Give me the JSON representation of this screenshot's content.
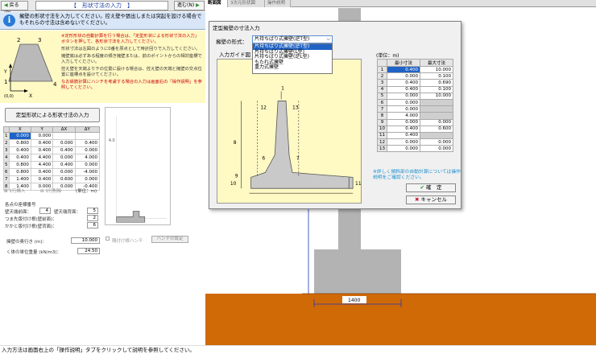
{
  "nav": {
    "back_label": "戻る(P)",
    "next_label": "進む(N)",
    "title": "【　形状寸法の入力　】"
  },
  "info": {
    "text": "擁壁の形状寸法を入力してください。控え壁や張出しまたは突起を設ける場合でもそれらの寸法は含めないでください。"
  },
  "help": {
    "p1": "※定形形状の自動計算を行う場合は、「定型形状による形状寸法の入力」ボタンを押して、各形状寸法を入力してください。",
    "p2": "形状寸法は左図のように0番を原点として時計回りで入力してください。",
    "p3": "擁壁底は必ずある程度の傾き擁壁または、前のポイントからの相対座標で入力してください。",
    "p4": "控え壁を天端より下の位置に設ける場合は、控え壁の天端と擁壁の交点位置に座標点を設けてください。",
    "p5": "なお鉄筋計算にハンチを考慮する場合の入力は画面右の「操作説明」を参照してください。",
    "pt_labels": [
      "2",
      "3",
      "1",
      "4",
      "Y",
      "X",
      "(0,0)"
    ]
  },
  "shape_button_label": "定型形状による形状寸法の入力",
  "coord_table": {
    "headers": [
      "",
      "X",
      "Y",
      "ΔX",
      "ΔY"
    ],
    "rows": [
      [
        "1",
        "0.000",
        "0.000",
        "",
        ""
      ],
      [
        "2",
        "0.800",
        "0.400",
        "0.000",
        "0.400"
      ],
      [
        "3",
        "0.400",
        "0.400",
        "0.400",
        "0.000"
      ],
      [
        "4",
        "0.400",
        "4.400",
        "0.000",
        "4.000"
      ],
      [
        "5",
        "0.800",
        "4.400",
        "0.400",
        "0.000"
      ],
      [
        "6",
        "0.800",
        "0.400",
        "0.000",
        "-4.000"
      ],
      [
        "7",
        "1.400",
        "0.400",
        "0.600",
        "0.000"
      ],
      [
        "8",
        "1.400",
        "0.000",
        "0.000",
        "-0.400"
      ]
    ]
  },
  "row_ops": {
    "insert": "1行挿入",
    "delete": "1行削除",
    "unit": "(単位：m)"
  },
  "mini_prev": {
    "ylabel": "4.0"
  },
  "points": {
    "title": "各点の座標番号",
    "front_top_label": "壁天端前面：",
    "front_top": "4",
    "back_top_label": "壁天端背面：",
    "back_top": "5",
    "toe_label": "つま先版付け根(壁前面)：",
    "toe": "2",
    "heel_label": "かかと版付け根(壁背面)：",
    "heel": "6"
  },
  "fields": {
    "depth_label": "擁壁の奥行き (m)：",
    "depth_value": "10.000",
    "weight_label": "く体の単位重量 (kN/m3)：",
    "weight_value": "24.50",
    "haunch_check": "隅付け根ハンチ",
    "haunch_btn": "ハンチの設定"
  },
  "status": "入力方法は画面右上の「操作説明」タブをクリックして説明を参照してください。",
  "tabs": [
    "断面図",
    "3次元形状図",
    "操作説明"
  ],
  "drawing": {
    "dim_label": "1400"
  },
  "dialog": {
    "title": "定型擁壁の寸法入力",
    "wall_type_label": "擁壁の形式：",
    "wall_type_value": "片持ちばり式擁壁(逆T型)",
    "guide_label": "入力ガイド図",
    "options": [
      "片持ちばり式擁壁(逆T型)",
      "片持ちばり式擁壁(L型)",
      "片持ちばり式擁壁(逆L型)",
      "もたれ式擁壁",
      "重力式擁壁"
    ],
    "unit": "(単位：m)",
    "table_headers": [
      "",
      "最小寸法",
      "最大寸法"
    ],
    "table_rows": [
      [
        "1",
        "0.400",
        "10.000"
      ],
      [
        "2",
        "0.000",
        "0.100"
      ],
      [
        "3",
        "0.400",
        "0.690"
      ],
      [
        "4",
        "0.400",
        "0.100"
      ],
      [
        "5",
        "0.000",
        "10.000"
      ],
      [
        "6",
        "0.000",
        ""
      ],
      [
        "7",
        "0.000",
        ""
      ],
      [
        "8",
        "4.000",
        ""
      ],
      [
        "9",
        "0.000",
        "0.000"
      ],
      [
        "10",
        "0.400",
        "0.600"
      ],
      [
        "11",
        "0.400",
        ""
      ],
      [
        "12",
        "0.000",
        "0.000"
      ],
      [
        "13",
        "0.000",
        "0.000"
      ]
    ],
    "guide_numbers": [
      "1",
      "12",
      "13",
      "6",
      "7",
      "8",
      "9",
      "10",
      "11"
    ],
    "note": "※詳しく傾斜部の自動計算については操作説明をご確認ください。",
    "ok_label": "確　定",
    "cancel_label": "キャンセル"
  }
}
